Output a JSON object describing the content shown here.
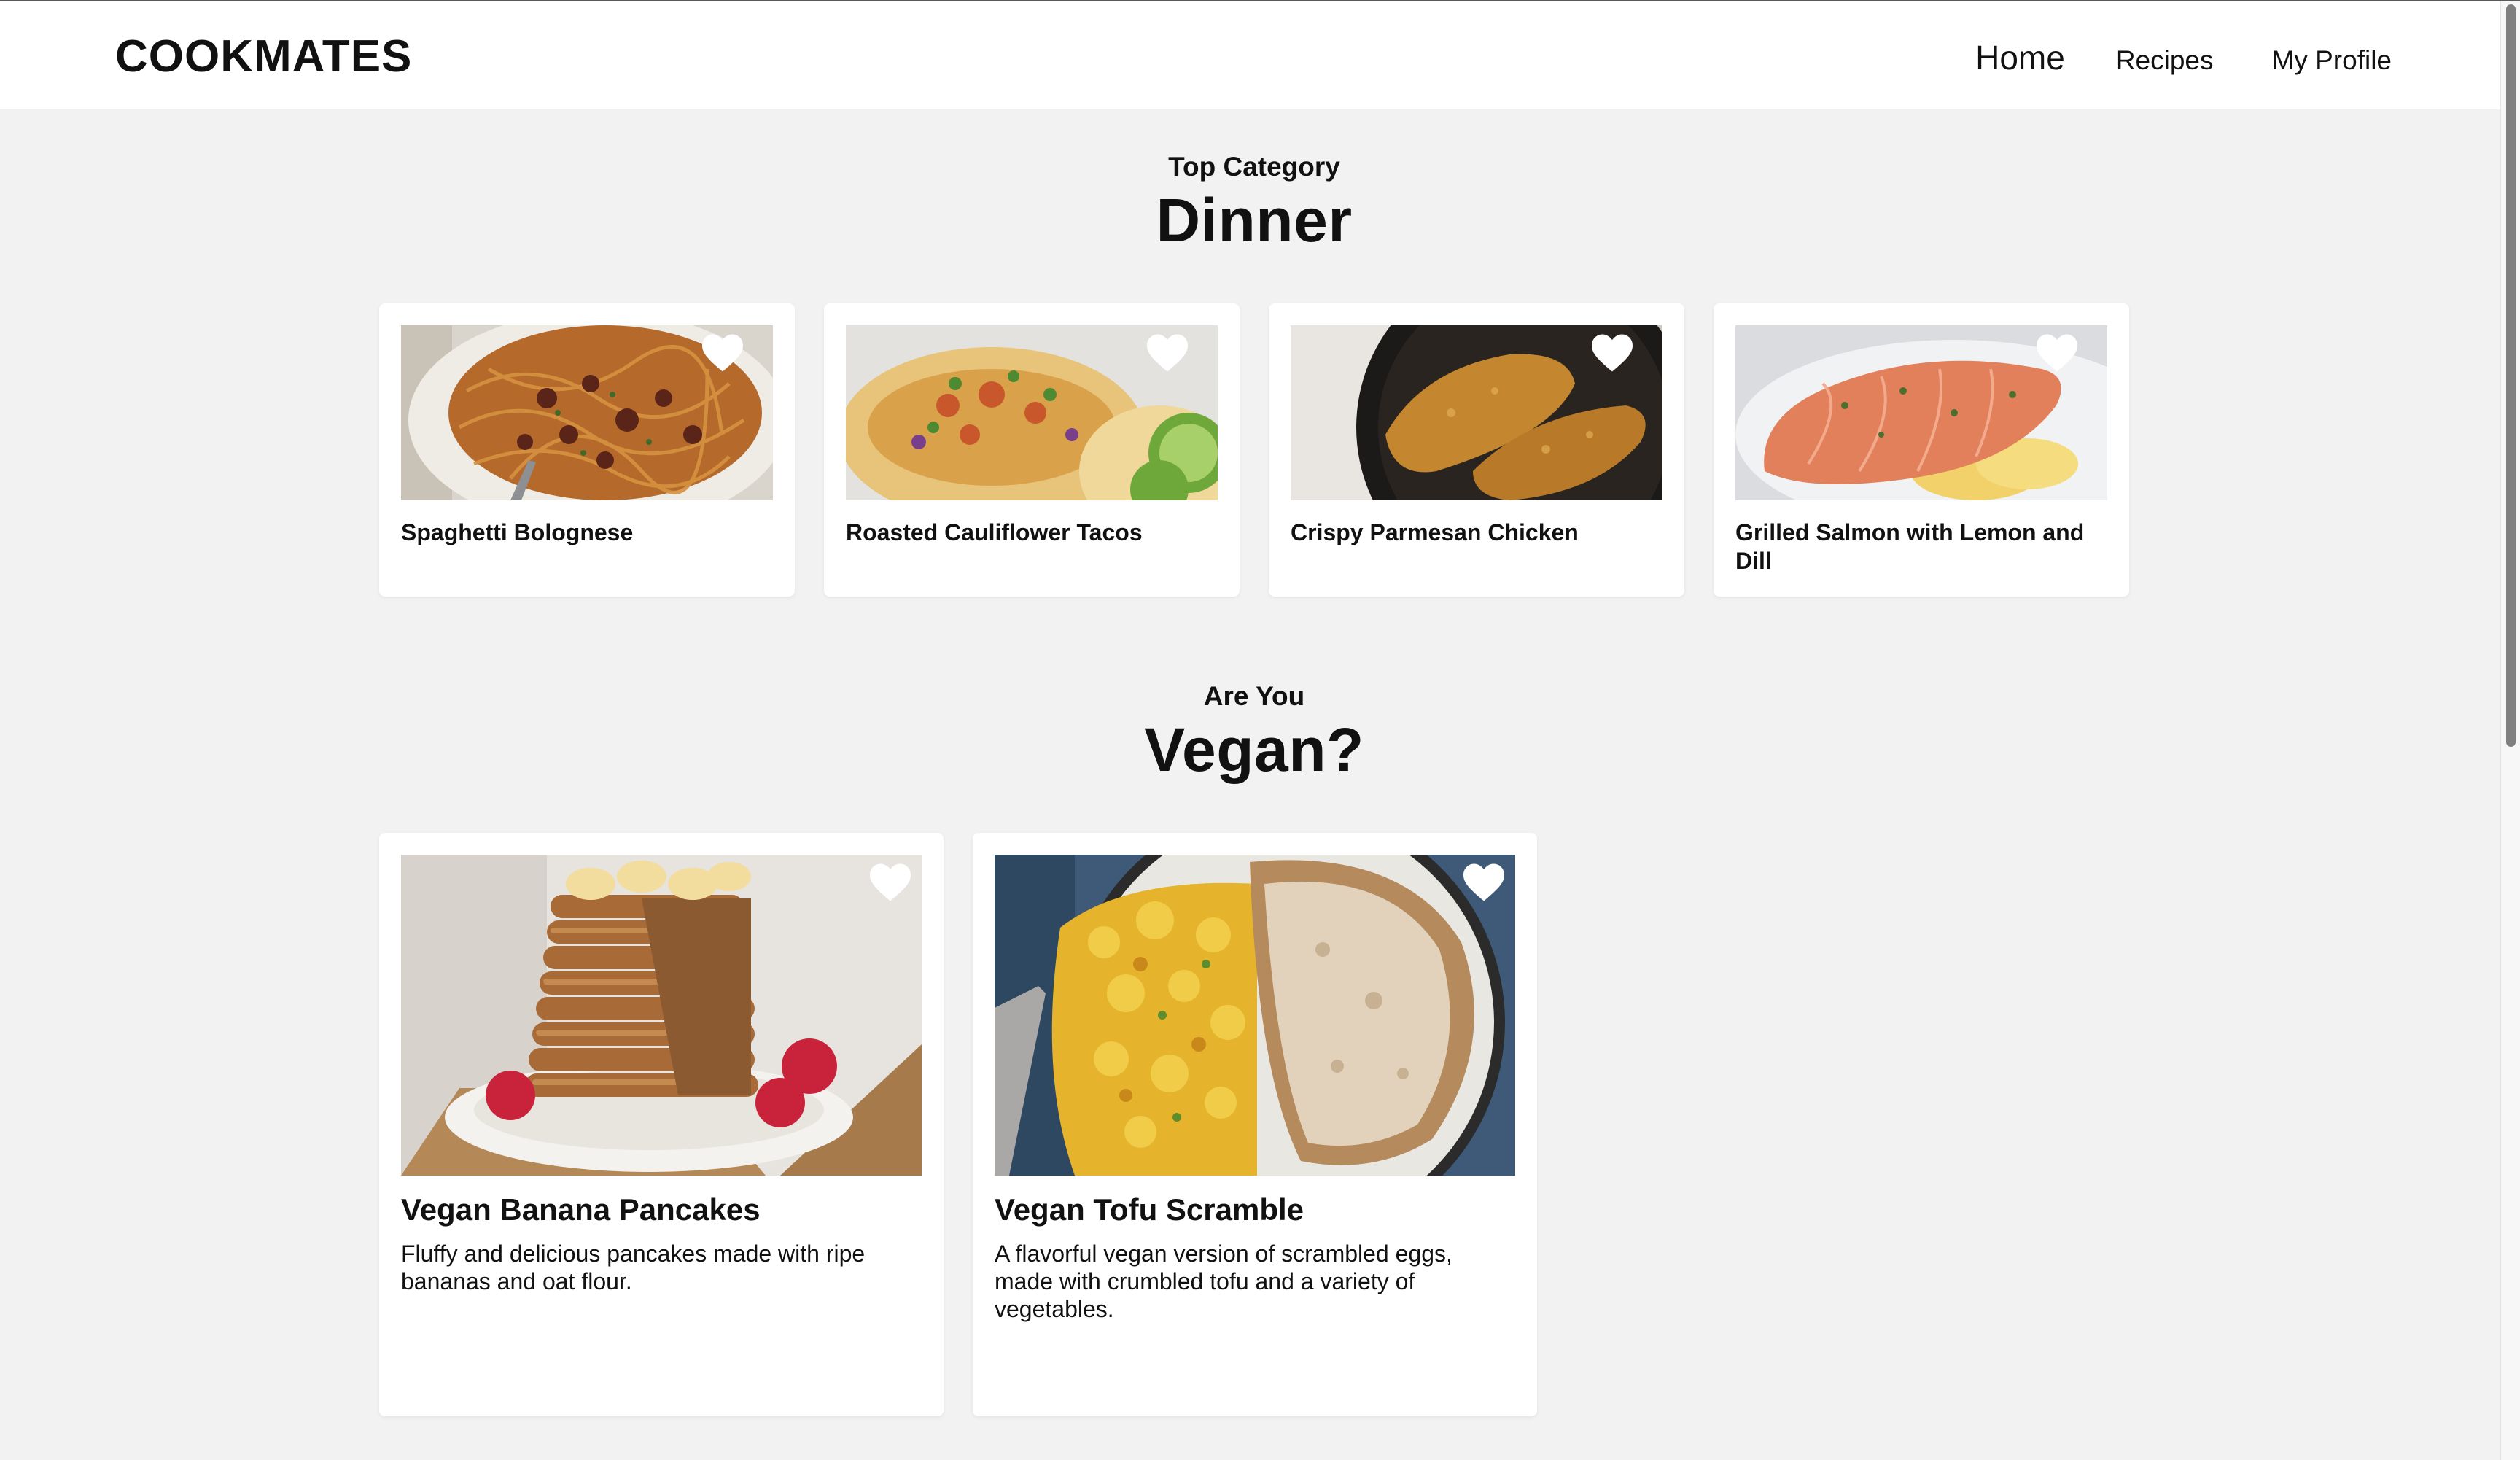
{
  "header": {
    "logo": "COOKMATES",
    "nav": [
      {
        "label": "Home"
      },
      {
        "label": "Recipes"
      },
      {
        "label": "My Profile"
      }
    ]
  },
  "sections": [
    {
      "subtitle": "Top Category",
      "title": "Dinner",
      "cards": [
        {
          "title": "Spaghetti Bolognese",
          "image": "spaghetti-bolognese-photo"
        },
        {
          "title": "Roasted Cauliflower Tacos",
          "image": "cauliflower-tacos-photo"
        },
        {
          "title": "Crispy Parmesan Chicken",
          "image": "parmesan-chicken-photo"
        },
        {
          "title": "Grilled Salmon with Lemon and Dill",
          "image": "grilled-salmon-photo"
        }
      ]
    },
    {
      "subtitle": "Are You",
      "title": "Vegan?",
      "cards": [
        {
          "title": "Vegan Banana Pancakes",
          "description": "Fluffy and delicious pancakes made with ripe bananas and oat flour.",
          "image": "banana-pancakes-photo"
        },
        {
          "title": "Vegan Tofu Scramble",
          "description": "A flavorful vegan version of scrambled eggs, made with crumbled tofu and a variety of vegetables.",
          "image": "tofu-scramble-photo"
        }
      ]
    }
  ],
  "icons": {
    "favorite": "heart-icon"
  },
  "colors": {
    "background": "#f2f2f2",
    "header": "#ffffff",
    "card": "#ffffff",
    "text": "#111111"
  }
}
